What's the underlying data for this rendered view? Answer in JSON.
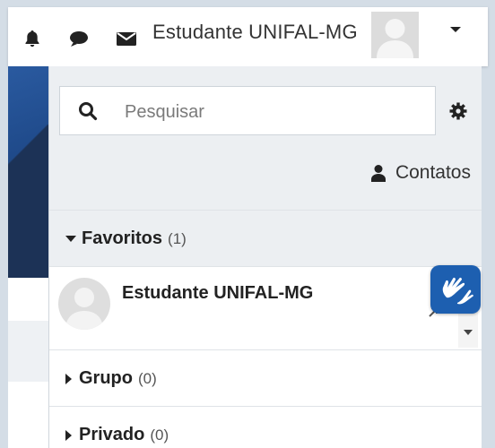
{
  "topbar": {
    "icons": [
      "bell-icon",
      "chat-bubble-icon",
      "envelope-icon"
    ],
    "user_name": "Estudante UNIFAL-MG",
    "menu_icon": "caret-down-icon"
  },
  "drawer": {
    "search": {
      "placeholder": "Pesquisar",
      "value": "",
      "icon": "search-icon"
    },
    "settings_icon": "gear-icon",
    "contacts_label": "Contatos",
    "sections": {
      "favorites": {
        "label": "Favoritos",
        "count": "(1)",
        "expanded": true
      },
      "group": {
        "label": "Grupo",
        "count": "(0)",
        "expanded": false
      },
      "private": {
        "label": "Privado",
        "count": "(0)",
        "expanded": false
      }
    },
    "favorite_contacts": [
      {
        "name": "Estudante UNIFAL-MG"
      }
    ]
  },
  "accessibility_widget": {
    "icon": "sign-language-hands-icon",
    "color": "#1d5fb0"
  },
  "colors": {
    "accent": "#1d5fb0",
    "drawer_bg": "#eceff2"
  }
}
